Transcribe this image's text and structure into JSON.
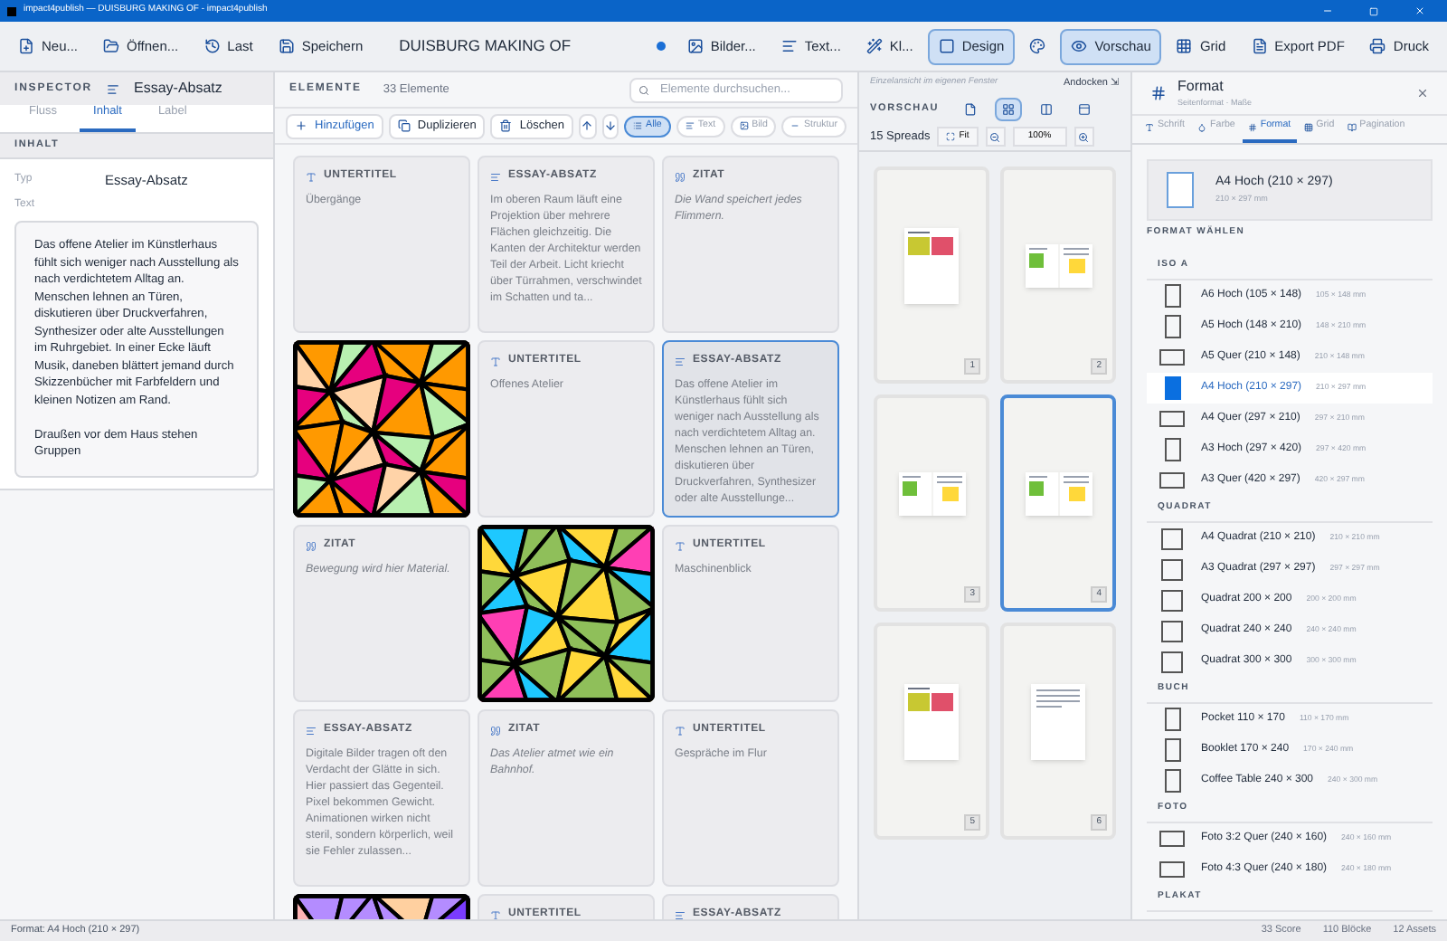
{
  "window": {
    "title": "impact4publish — DUISBURG MAKING OF - impact4publish"
  },
  "toolbar": {
    "left": [
      {
        "label": "Neu..."
      },
      {
        "label": "Öffnen..."
      },
      {
        "label": "Last"
      },
      {
        "label": "Speichern"
      }
    ],
    "document_title": "DUISBURG MAKING OF",
    "right": [
      {
        "label": "Bilder...",
        "selected": false
      },
      {
        "label": "Text...",
        "selected": false
      },
      {
        "label": "Kl...",
        "selected": false
      },
      {
        "label": "Design",
        "selected": true
      },
      {
        "selected": false
      },
      {
        "label": "Vorschau",
        "selected": true
      },
      {
        "label": "Grid",
        "selected": false
      },
      {
        "label": "Export PDF",
        "selected": false
      },
      {
        "label": "Druck",
        "selected": false
      }
    ]
  },
  "inspector": {
    "title": "INSPECTOR",
    "subtitle": "Essay-Absatz",
    "tabs": [
      {
        "label": "Fluss",
        "selected": false
      },
      {
        "label": "Inhalt",
        "selected": true
      },
      {
        "label": "Label",
        "selected": false
      }
    ],
    "section": "INHALT",
    "type_label": "Typ",
    "type_value": "Essay-Absatz",
    "text_label": "Text",
    "text_value": "Das offene Atelier im Künstlerhaus fühlt sich weniger nach Ausstellung als nach verdichtetem Alltag an. Menschen lehnen an Türen, diskutieren über Druckverfahren, Synthesizer oder alte Ausstellungen im Ruhrgebiet. In einer Ecke läuft Musik, daneben blättert jemand durch Skizzenbücher mit Farbfeldern und kleinen Notizen am Rand.\n\nDraußen vor dem Haus stehen Gruppen"
  },
  "elements": {
    "title": "ELEMENTE",
    "count": "33 Elemente",
    "search": {
      "placeholder": "Elemente durchsuchen..."
    },
    "actions": [
      {
        "label": "Hinzufügen"
      },
      {
        "label": "Duplizieren"
      },
      {
        "label": "Löschen"
      }
    ],
    "filters": [
      {
        "label": "Alle",
        "selected": true
      },
      {
        "label": "Text",
        "selected": false
      },
      {
        "label": "Bild",
        "selected": false
      },
      {
        "label": "Struktur",
        "selected": false
      }
    ],
    "cards": [
      {
        "kind": "untertitel",
        "label": "UNTERTITEL",
        "text": "Übergänge",
        "selected": false
      },
      {
        "kind": "essay",
        "label": "ESSAY-ABSATZ",
        "text": "Im oberen Raum läuft eine Projektion über mehrere Flächen gleichzeitig. Die Kanten der Architektur werden Teil der Arbeit. Licht kriecht über Türrahmen, verschwindet im Schatten und ta...",
        "selected": false
      },
      {
        "kind": "zitat",
        "label": "ZITAT",
        "text": "Die Wand speichert jedes Flimmern.",
        "selected": false
      },
      {
        "kind": "image",
        "selected": false
      },
      {
        "kind": "untertitel",
        "label": "UNTERTITEL",
        "text": "Offenes Atelier",
        "selected": false
      },
      {
        "kind": "essay",
        "label": "ESSAY-ABSATZ",
        "text": "Das offene Atelier im Künstlerhaus fühlt sich weniger nach Ausstellung als nach verdichtetem Alltag an. Menschen lehnen an Türen, diskutieren über Druckverfahren, Synthesizer oder alte Ausstellunge...",
        "selected": true
      },
      {
        "kind": "zitat",
        "label": "ZITAT",
        "text": "Bewegung wird hier Material.",
        "selected": false
      },
      {
        "kind": "image",
        "selected": false
      },
      {
        "kind": "untertitel",
        "label": "UNTERTITEL",
        "text": "Maschinenblick",
        "selected": false
      },
      {
        "kind": "essay",
        "label": "ESSAY-ABSATZ",
        "text": "Digitale Bilder tragen oft den Verdacht der Glätte in sich. Hier passiert das Gegenteil. Pixel bekommen Gewicht. Animationen wirken nicht steril, sondern körperlich, weil sie Fehler zulassen...",
        "selected": false
      },
      {
        "kind": "zitat",
        "label": "ZITAT",
        "text": "Das Atelier atmet wie ein Bahnhof.",
        "selected": false
      },
      {
        "kind": "untertitel",
        "label": "UNTERTITEL",
        "text": "Gespräche im Flur",
        "selected": false
      },
      {
        "kind": "image",
        "selected": false
      },
      {
        "kind": "untertitel",
        "label": "UNTERTITEL",
        "selected": false
      },
      {
        "kind": "essay",
        "label": "ESSAY-ABSATZ",
        "selected": false
      }
    ]
  },
  "preview": {
    "detach_hint": "Einzelansicht im eigenen Fenster",
    "dock": "Andocken ⇲",
    "title": "VORSCHAU",
    "views": [
      {
        "selected": false
      },
      {
        "selected": true
      },
      {
        "selected": false
      },
      {
        "selected": false
      }
    ],
    "spreads": "15 Spreads",
    "fit": "Fit",
    "zoom": "100%",
    "pages": [
      {
        "number": "1",
        "kind": "single",
        "selected": false
      },
      {
        "number": "2",
        "kind": "spread",
        "selected": false
      },
      {
        "number": "3",
        "kind": "spread",
        "selected": false
      },
      {
        "number": "4",
        "kind": "spread",
        "selected": true
      },
      {
        "number": "5",
        "kind": "single",
        "selected": false
      },
      {
        "number": "6",
        "kind": "text",
        "selected": false
      }
    ]
  },
  "format": {
    "title": "Format",
    "subtitle": "Seitenformat · Maße",
    "tabs": [
      {
        "label": "Schrift",
        "selected": false
      },
      {
        "label": "Farbe",
        "selected": false
      },
      {
        "label": "Format",
        "selected": true
      },
      {
        "label": "Grid",
        "selected": false
      },
      {
        "label": "Pagination",
        "selected": false
      }
    ],
    "current": {
      "label": "A4 Hoch (210 × 297)",
      "size": "210 × 297 mm"
    },
    "choose": "FORMAT WÄHLEN",
    "groups": [
      {
        "name": "ISO A",
        "items": [
          {
            "label": "A6 Hoch (105 × 148)",
            "size": "105 × 148 mm",
            "kind": "portrait",
            "selected": false
          },
          {
            "label": "A5 Hoch (148 × 210)",
            "size": "148 × 210 mm",
            "kind": "portrait",
            "selected": false
          },
          {
            "label": "A5 Quer (210 × 148)",
            "size": "210 × 148 mm",
            "kind": "landscape",
            "selected": false
          },
          {
            "label": "A4 Hoch (210 × 297)",
            "size": "210 × 297 mm",
            "kind": "portrait",
            "selected": true
          },
          {
            "label": "A4 Quer (297 × 210)",
            "size": "297 × 210 mm",
            "kind": "landscape",
            "selected": false
          },
          {
            "label": "A3 Hoch (297 × 420)",
            "size": "297 × 420 mm",
            "kind": "portrait",
            "selected": false
          },
          {
            "label": "A3 Quer (420 × 297)",
            "size": "420 × 297 mm",
            "kind": "landscape",
            "selected": false
          }
        ]
      },
      {
        "name": "QUADRAT",
        "items": [
          {
            "label": "A4 Quadrat (210 × 210)",
            "size": "210 × 210 mm",
            "kind": "square",
            "selected": false
          },
          {
            "label": "A3 Quadrat (297 × 297)",
            "size": "297 × 297 mm",
            "kind": "square",
            "selected": false
          },
          {
            "label": "Quadrat 200 × 200",
            "size": "200 × 200 mm",
            "kind": "square",
            "selected": false
          },
          {
            "label": "Quadrat 240 × 240",
            "size": "240 × 240 mm",
            "kind": "square",
            "selected": false
          },
          {
            "label": "Quadrat 300 × 300",
            "size": "300 × 300 mm",
            "kind": "square",
            "selected": false
          }
        ]
      },
      {
        "name": "BUCH",
        "items": [
          {
            "label": "Pocket 110 × 170",
            "size": "110 × 170 mm",
            "kind": "portrait",
            "selected": false
          },
          {
            "label": "Booklet 170 × 240",
            "size": "170 × 240 mm",
            "kind": "portrait",
            "selected": false
          },
          {
            "label": "Coffee Table 240 × 300",
            "size": "240 × 300 mm",
            "kind": "portrait",
            "selected": false
          }
        ]
      },
      {
        "name": "FOTO",
        "items": [
          {
            "label": "Foto 3:2 Quer (240 × 160)",
            "size": "240 × 160 mm",
            "kind": "landscape",
            "selected": false
          },
          {
            "label": "Foto 4:3 Quer (240 × 180)",
            "size": "240 × 180 mm",
            "kind": "landscape",
            "selected": false
          }
        ]
      },
      {
        "name": "PLAKAT"
      }
    ]
  },
  "status_bar": {
    "left": "Format: A4 Hoch (210 × 297)",
    "right": [
      "33 Score",
      "110 Blöcke",
      "12 Assets"
    ]
  }
}
